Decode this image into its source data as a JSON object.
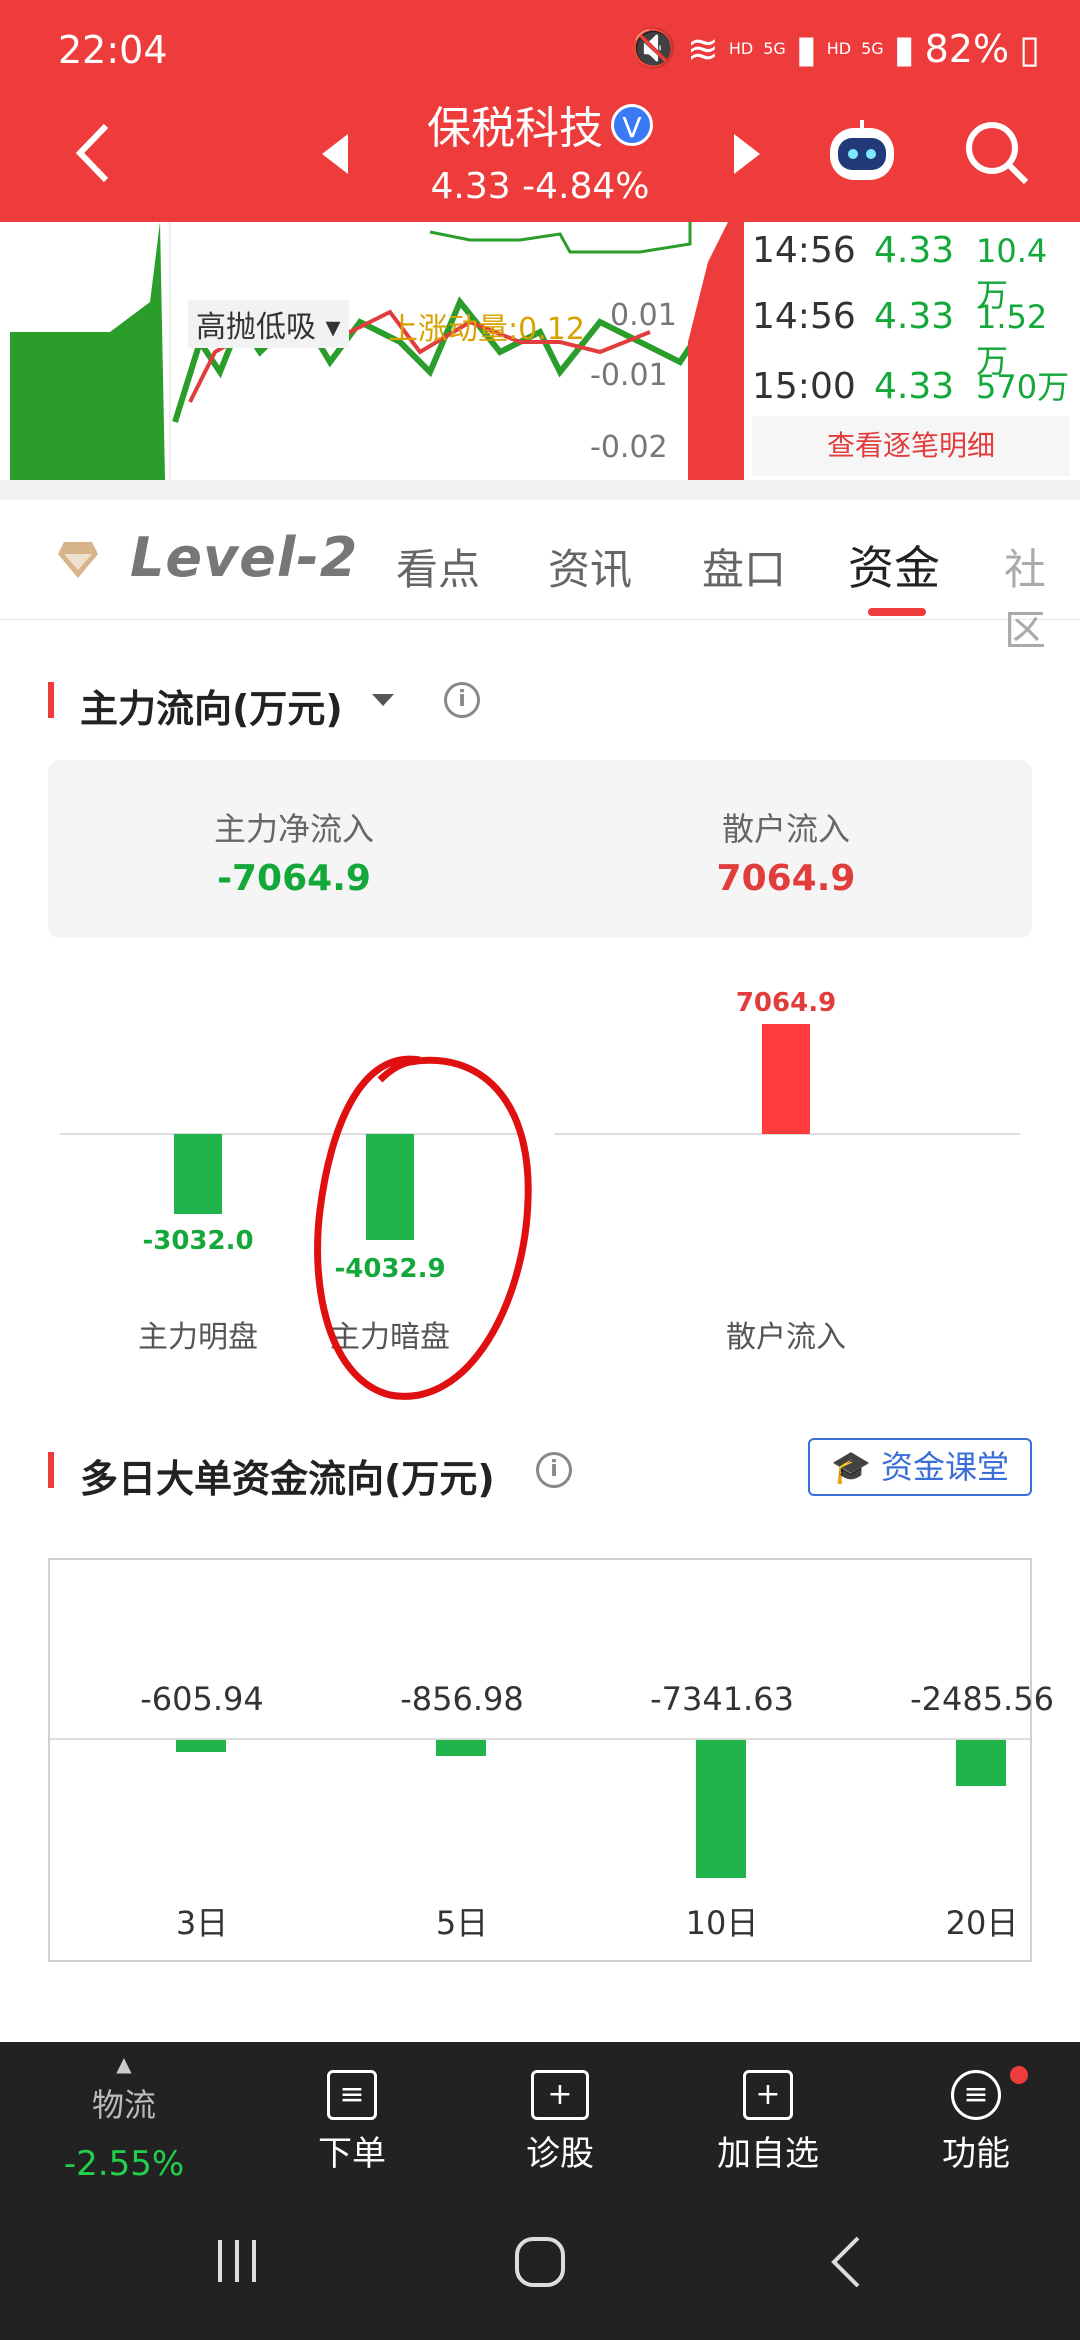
{
  "status": {
    "time": "22:04",
    "battery": "82%",
    "network_hd1": "HD",
    "network_5g1": "5G",
    "network_hd2": "HD",
    "network_5g2": "5G"
  },
  "header": {
    "stock_name": "保税科技",
    "price_line": "4.33 -4.84%",
    "verified_mark": "V"
  },
  "chart": {
    "overlay_tag": "高抛低吸",
    "momentum": "上涨动量:0.12",
    "axis": [
      "0.01",
      "-0.01",
      "-0.02"
    ]
  },
  "trades": [
    {
      "time": "14:56",
      "price": "4.33",
      "vol": "10.4万"
    },
    {
      "time": "14:56",
      "price": "4.33",
      "vol": "1.52万"
    },
    {
      "time": "15:00",
      "price": "4.33",
      "vol": "570万"
    }
  ],
  "detail_link": "查看逐笔明细",
  "tabs": {
    "level2": "Level-2",
    "items": [
      "看点",
      "资讯",
      "盘口",
      "资金",
      "社区"
    ]
  },
  "main_flow": {
    "title": "主力流向(万元)",
    "net_label": "主力净流入",
    "net_value": "-7064.9",
    "retail_label": "散户流入",
    "retail_value": "7064.9",
    "bars": [
      {
        "label": "主力明盘",
        "value": "-3032.0"
      },
      {
        "label": "主力暗盘",
        "value": "-4032.9"
      },
      {
        "label": "散户流入",
        "value": "7064.9"
      }
    ]
  },
  "multi_day": {
    "title": "多日大单资金流向(万元)",
    "course_button": "资金课堂",
    "items": [
      {
        "day": "3日",
        "value": "-605.94"
      },
      {
        "day": "5日",
        "value": "-856.98"
      },
      {
        "day": "10日",
        "value": "-7341.63"
      },
      {
        "day": "20日",
        "value": "-2485.56"
      }
    ]
  },
  "bottom": {
    "sector_name": "物流",
    "sector_change": "-2.55%",
    "items": [
      "下单",
      "诊股",
      "加自选",
      "功能"
    ]
  },
  "colors": {
    "brand_red": "#ee3b3b",
    "down_green": "#14a83b",
    "up_red": "#e23d3d"
  }
}
